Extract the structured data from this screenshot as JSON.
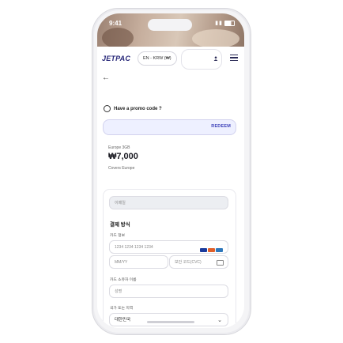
{
  "status": {
    "time": "9:41"
  },
  "header": {
    "logo": "JETPAC",
    "language_selector": "EN - KRW (₩)"
  },
  "promo": {
    "label": "Have a promo code ?",
    "redeem_label": "REDEEM"
  },
  "plan": {
    "name": "Europe 3GB",
    "price": "₩7,000",
    "coverage": "Covers Europe"
  },
  "checkout": {
    "email_placeholder": "이메일",
    "payment_title": "결제 방식",
    "card_info_label": "카드 정보",
    "card_number_placeholder": "1234 1234 1234 1234",
    "expiry_placeholder": "MM/YY",
    "cvc_placeholder": "보안 코드(CVC)",
    "cardholder_label": "카드 소유자 이름",
    "cardholder_placeholder": "성명",
    "country_label": "국가 또는 지역",
    "country_value": "대한민국"
  },
  "colors": {
    "accent": "#3b3fb8",
    "promo_bg": "#eef0ff",
    "logo": "#2a2a7a"
  }
}
